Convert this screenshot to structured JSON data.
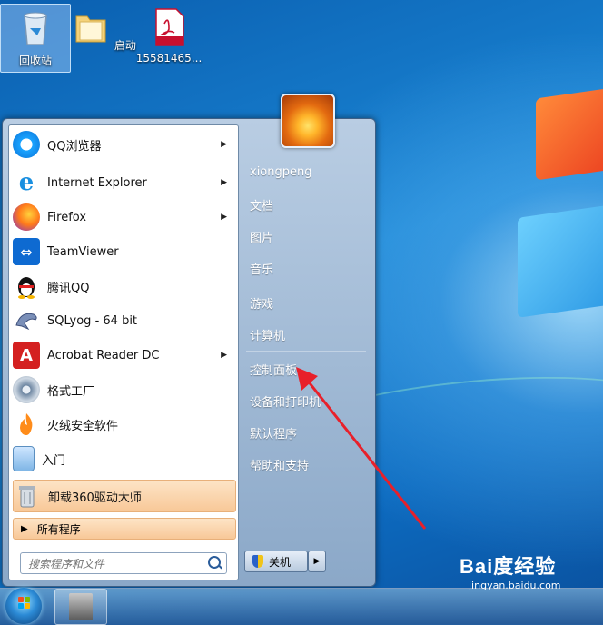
{
  "desktop": {
    "icons": [
      {
        "label": "回收站",
        "icon": "recycle-bin-icon"
      },
      {
        "label": "启动",
        "icon": "folder-icon"
      },
      {
        "label": "15581465...",
        "icon": "pdf-file-icon",
        "badge": "PDF"
      }
    ]
  },
  "start_menu": {
    "programs": [
      {
        "label": "QQ浏览器",
        "icon": "qq-browser-icon",
        "has_submenu": true
      },
      {
        "label": "Internet Explorer",
        "icon": "internet-explorer-icon",
        "has_submenu": true
      },
      {
        "label": "Firefox",
        "icon": "firefox-icon",
        "has_submenu": true
      },
      {
        "label": "TeamViewer",
        "icon": "teamviewer-icon",
        "has_submenu": false
      },
      {
        "label": "腾讯QQ",
        "icon": "qq-penguin-icon",
        "has_submenu": false
      },
      {
        "label": "SQLyog - 64 bit",
        "icon": "sqlyog-dolphin-icon",
        "has_submenu": false
      },
      {
        "label": "Acrobat Reader DC",
        "icon": "acrobat-reader-icon",
        "has_submenu": true
      },
      {
        "label": "格式工厂",
        "icon": "format-factory-icon",
        "has_submenu": false
      },
      {
        "label": "火绒安全软件",
        "icon": "huorong-security-icon",
        "has_submenu": false
      },
      {
        "label": "入门",
        "icon": "getting-started-icon",
        "has_submenu": false
      },
      {
        "label": "卸载360驱动大师",
        "icon": "uninstall-icon",
        "has_submenu": false
      }
    ],
    "all_programs": "所有程序",
    "search_placeholder": "搜索程序和文件",
    "user_name": "xiongpeng",
    "right_items": [
      "文档",
      "图片",
      "音乐",
      "游戏",
      "计算机",
      "控制面板",
      "设备和打印机",
      "默认程序",
      "帮助和支持"
    ],
    "shutdown_label": "关机"
  },
  "watermark": {
    "brand": "Bai度经验",
    "url": "jingyan.baidu.com"
  },
  "colors": {
    "highlight": "#f8c898",
    "arrow": "#e8202a",
    "desktop_blue": "#1b87d6"
  }
}
